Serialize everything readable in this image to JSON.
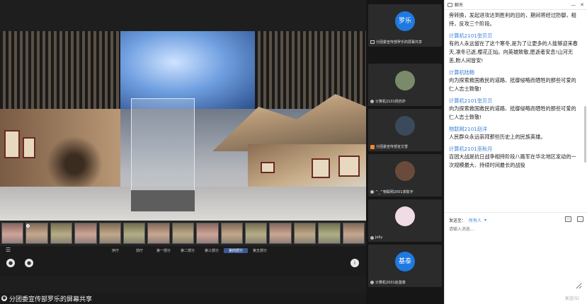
{
  "share": {
    "thumbnails": [
      {
        "label": "",
        "pinned": false
      },
      {
        "label": "",
        "pinned": true
      },
      {
        "label": "",
        "pinned": false
      },
      {
        "label": "",
        "pinned": false
      },
      {
        "label": "",
        "pinned": false
      },
      {
        "label": "",
        "pinned": false
      },
      {
        "label": "",
        "pinned": false
      },
      {
        "label": "",
        "pinned": false
      },
      {
        "label": "",
        "pinned": false
      },
      {
        "label": "",
        "pinned": false
      },
      {
        "label": "",
        "pinned": false
      },
      {
        "label": "",
        "pinned": false
      },
      {
        "label": "",
        "pinned": false
      },
      {
        "label": "",
        "pinned": false
      },
      {
        "label": "",
        "pinned": false
      }
    ],
    "nav_tabs": [
      "序厅",
      "前厅",
      "第一部分",
      "第二部分",
      "第三部分",
      "第四部分",
      "第五部分"
    ],
    "nav_active_index": 5,
    "footer_text": "分团委宣传部罗乐的屏幕共享"
  },
  "participants": [
    {
      "avatar_text": "罗乐",
      "avatar_color": "#1f7ae0",
      "name": "分团委宣传部罗乐的屏幕共享",
      "badge": "share"
    },
    {
      "avatar_text": "",
      "avatar_color": "#7a8a6a",
      "name": "计算机2101杨苏炸",
      "badge": "mic"
    },
    {
      "avatar_text": "",
      "avatar_color": "#3a4a5a",
      "name": "分团委宣传部宣文雪",
      "badge": "orange"
    },
    {
      "avatar_text": "",
      "avatar_color": "#6a4a3a",
      "name": "^_^物联网2001龚陈宇",
      "badge": "mic"
    },
    {
      "avatar_text": "",
      "avatar_color": "#f0dce4",
      "name": "Jelly",
      "badge": "mic"
    },
    {
      "avatar_text": "基泰",
      "avatar_color": "#1f7ae0",
      "name": "计算机2001赵基泰",
      "badge": "mic"
    }
  ],
  "chat": {
    "title": "聊天",
    "messages": [
      {
        "sender": "",
        "text": "旁转换，发起进攻达到胜利的目的，期间将经过防御，相持，反攻三个阶段。"
      },
      {
        "sender": "计算机2101张贝贝",
        "text": "有的人永远留在了这个寒冬,是为了让更多的人能够迎来春天,凛冬已逝,樱花正灿。向英雄致敬,愿逝者安息!山河无恙,盼人间皆安!"
      },
      {
        "sender": "计算机陆畅",
        "text": "向为探索救国救民的道路、抵御侵略而牺牲的那些可爱的仁人志士致敬!"
      },
      {
        "sender": "计算机2101张贝贝",
        "text": "向为探索救国救民的道路、抵御侵略而牺牲的那些可爱的仁人志士致敬!"
      },
      {
        "sender": "物联网2101赵洋",
        "text": "人民群众永远崇拜那些历史上的民族英雄。"
      },
      {
        "sender": "计算机2101巫秋月",
        "text": "百团大战是抗日战争相持阶段八路军在华北地区发动的一次规模最大、持续时间最长的战役"
      }
    ],
    "send_to_label": "发送至：",
    "send_to_value": "所有人",
    "input_placeholder": "请输入消息...",
    "send_button": "发送(S)"
  }
}
